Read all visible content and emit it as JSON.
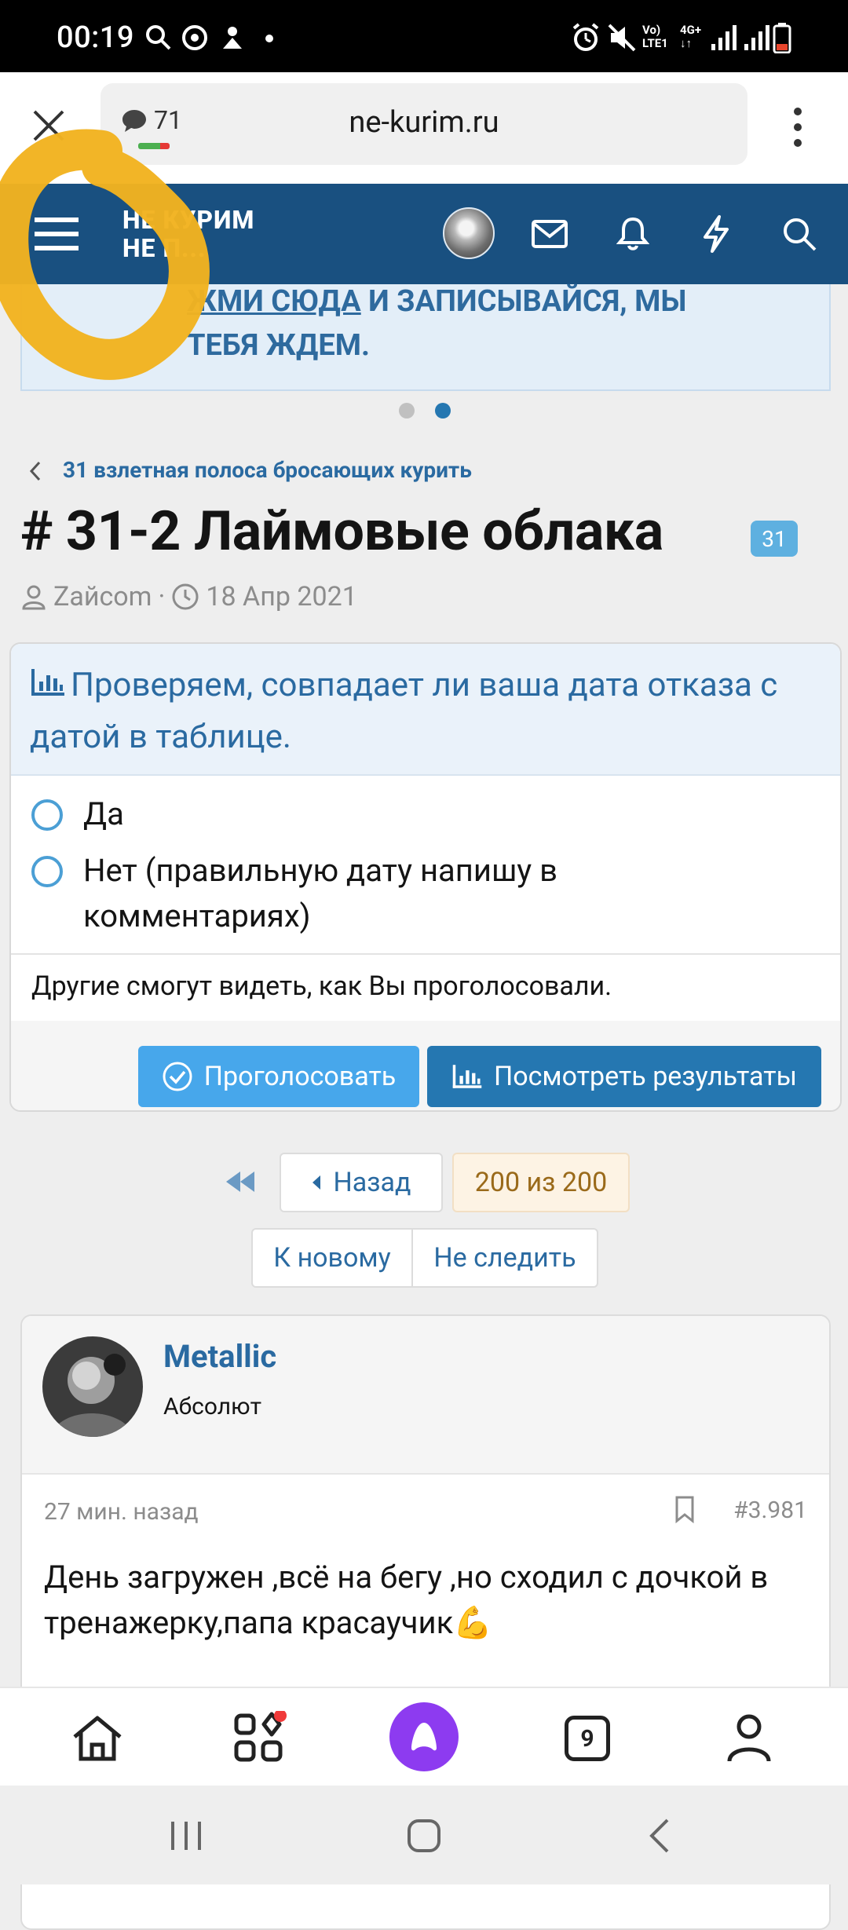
{
  "status_bar": {
    "time": "00:19",
    "network_label_1": "Vo)",
    "network_label_2": "LTE1",
    "network_label_3": "4G+"
  },
  "browser": {
    "url": "ne-kurim.ru",
    "comment_count": "71"
  },
  "site_header": {
    "logo_line1": "НЕ КУРИМ",
    "logo_line2": "НЕ П..."
  },
  "banner": {
    "line1_link": "ЖМИ СЮДА",
    "line1_rest": " И ЗАПИСЫВАЙСЯ, МЫ",
    "line2": "ТЕБЯ ЖДЕМ."
  },
  "breadcrumb": "31 взлетная полоса бросающих курить",
  "thread": {
    "title": "# 31-2 Лаймовые облака",
    "badge": "31",
    "author": "Zaйcom",
    "date": "18 Апр 2021"
  },
  "poll": {
    "question": "Проверяем, совпадает ли ваша дата отказа с датой в таблице.",
    "options": [
      "Да",
      "Нет (правильную дату напишу в комментариях)"
    ],
    "note": "Другие смогут видеть, как Вы проголосовали.",
    "vote_button": "Проголосовать",
    "results_button": "Посмотреть результаты"
  },
  "pagination": {
    "back_label": "Назад",
    "page_status": "200 из 200",
    "to_new": "К новому",
    "unwatch": "Не следить"
  },
  "post": {
    "username": "Metallic",
    "user_title": "Абсолют",
    "time": "27 мин. назад",
    "number": "#3.981",
    "text": "День загружен ,всё на бегу ,но сходил с дочкой в тренажерку,папа красаучик💪"
  },
  "bottom_nav": {
    "tabs_count": "9"
  },
  "colors": {
    "header_bg": "#195080",
    "accent_blue": "#2a6aa1",
    "vote_button": "#47a7eb",
    "results_button": "#2577b1",
    "highlight_marker": "#f2b320",
    "alice_purple": "#8d3bf0"
  }
}
